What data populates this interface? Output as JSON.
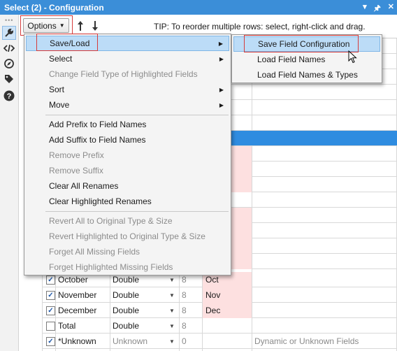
{
  "window": {
    "title": "Select (2) - Configuration",
    "pin_icon": "pin-icon",
    "dropdown_icon": "chevron-down-icon",
    "close_icon": "close-icon"
  },
  "toolbar": {
    "options_label": "Options",
    "move_up_icon": "arrow-up-icon",
    "move_down_icon": "arrow-down-icon",
    "tip": "TIP: To reorder multiple rows: select, right-click and drag."
  },
  "left_strip": {
    "icons": [
      "wrench-icon",
      "code-icon",
      "compass-icon",
      "tag-icon",
      "help-icon"
    ]
  },
  "options_menu": {
    "items": [
      {
        "label": "Save/Load",
        "submenu": true,
        "enabled": true,
        "highlighted": true
      },
      {
        "label": "Select",
        "submenu": true,
        "enabled": true
      },
      {
        "label": "Change Field Type of Highlighted Fields",
        "enabled": false
      },
      {
        "label": "Sort",
        "submenu": true,
        "enabled": true
      },
      {
        "label": "Move",
        "submenu": true,
        "enabled": true
      },
      {
        "label": "Add Prefix to Field Names",
        "enabled": true
      },
      {
        "label": "Add Suffix to Field Names",
        "enabled": true
      },
      {
        "label": "Remove Prefix",
        "enabled": false
      },
      {
        "label": "Remove Suffix",
        "enabled": false
      },
      {
        "label": "Clear All Renames",
        "enabled": true
      },
      {
        "label": "Clear Highlighted Renames",
        "enabled": true
      },
      {
        "label": "Revert All to Original Type & Size",
        "enabled": false
      },
      {
        "label": "Revert Highlighted to Original Type & Size",
        "enabled": false
      },
      {
        "label": "Forget All Missing Fields",
        "enabled": false
      },
      {
        "label": "Forget Highlighted Missing Fields",
        "enabled": false
      }
    ]
  },
  "save_load_submenu": {
    "items": [
      {
        "label": "Save Field Configuration",
        "highlighted": true
      },
      {
        "label": "Load Field Names"
      },
      {
        "label": "Load Field Names & Types"
      }
    ]
  },
  "grid": {
    "rows": [
      {
        "checked": true,
        "field": "October",
        "type": "Double",
        "size": "8",
        "rename": "Oct",
        "description": ""
      },
      {
        "checked": true,
        "field": "November",
        "type": "Double",
        "size": "8",
        "rename": "Nov",
        "description": ""
      },
      {
        "checked": true,
        "field": "December",
        "type": "Double",
        "size": "8",
        "rename": "Dec",
        "description": ""
      },
      {
        "checked": false,
        "field": "Total",
        "type": "Double",
        "size": "8",
        "rename": "",
        "description": ""
      },
      {
        "checked": true,
        "field": "*Unknown",
        "type": "Unknown",
        "size": "0",
        "rename": "",
        "description": "Dynamic or Unknown Fields"
      }
    ]
  },
  "colors": {
    "title_bar": "#3b8ed8",
    "highlight": "#bcdcf7",
    "selected_row": "#2f8ce0",
    "rename_pink": "#fde0e0",
    "annotation_red": "#d63b3b"
  }
}
